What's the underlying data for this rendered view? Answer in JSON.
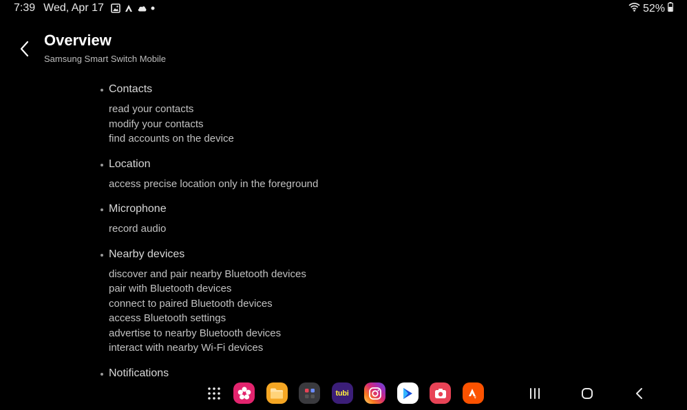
{
  "status_bar": {
    "time": "7:39",
    "date": "Wed, Apr 17",
    "battery": "52%"
  },
  "header": {
    "title": "Overview",
    "subtitle": "Samsung Smart Switch Mobile"
  },
  "sections": [
    {
      "title": "Contacts",
      "items": [
        "read your contacts",
        "modify your contacts",
        "find accounts on the device"
      ]
    },
    {
      "title": "Location",
      "items": [
        "access precise location only in the foreground"
      ]
    },
    {
      "title": "Microphone",
      "items": [
        "record audio"
      ]
    },
    {
      "title": "Nearby devices",
      "items": [
        "discover and pair nearby Bluetooth devices",
        "pair with Bluetooth devices",
        "connect to paired Bluetooth devices",
        "access Bluetooth settings",
        "advertise to nearby Bluetooth devices",
        "interact with nearby Wi-Fi devices"
      ]
    },
    {
      "title": "Notifications",
      "items": []
    }
  ],
  "taskbar": {
    "tubi_label": "tubi"
  },
  "colors": {
    "background": "#000000",
    "text_primary": "#ffffff",
    "text_secondary": "#c2c2c2",
    "blossom_pink": "#e3246e",
    "files_orange": "#f5a623",
    "tubi_purple": "#3b1e78",
    "instagram_gradient": "#c13584",
    "screen_recorder_red": "#e84356",
    "strava_orange": "#fc5200"
  }
}
